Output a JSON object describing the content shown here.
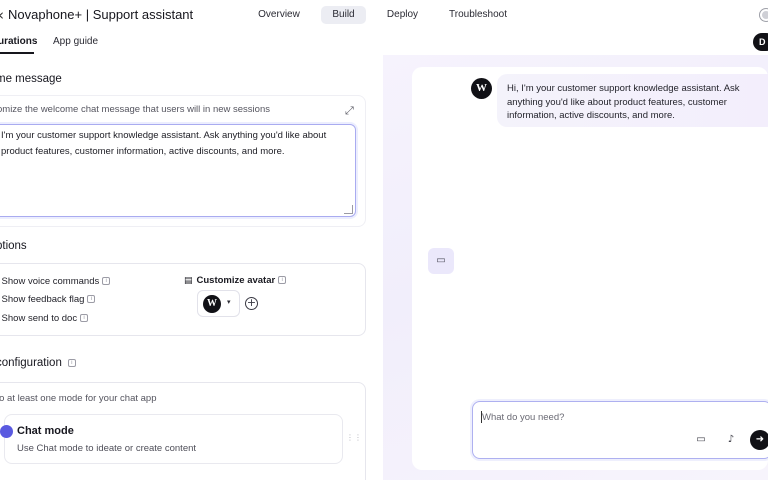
{
  "app": {
    "title": "Novaphone+ | Support assistant",
    "back_icon": "chevron-left-icon"
  },
  "nav": {
    "tabs": [
      {
        "label": "Overview",
        "active": false
      },
      {
        "label": "Build",
        "active": true
      },
      {
        "label": "Deploy",
        "active": false
      },
      {
        "label": "Troubleshoot",
        "active": false
      }
    ]
  },
  "subtabs": {
    "configurations": "urations",
    "app_guide": "App guide"
  },
  "top_right_pill": "D",
  "welcome": {
    "title": "me message",
    "hint": "omize the welcome chat message that users will in new sessions",
    "value": "I'm your customer support knowledge assistant. Ask anything you'd like about\nproduct features, customer information, active discounts, and more.",
    "expand_icon": "expand-icon"
  },
  "options": {
    "title": "ptions",
    "items": [
      {
        "label": "Show voice commands",
        "info": "i"
      },
      {
        "label": "Show feedback flag",
        "info": "i"
      },
      {
        "label": "Show send to doc",
        "info": "i"
      }
    ],
    "avatar": {
      "label": "Customize avatar",
      "info": "i",
      "selected_glyph": "W",
      "caret": "▾",
      "add_glyph": "+"
    }
  },
  "configuration": {
    "title": "configuration",
    "info": "i",
    "hint": "lo at least one mode for your chat app",
    "mode": {
      "title": "Chat mode",
      "description": "Use Chat mode to ideate or create content",
      "color": "#5a5ae0"
    }
  },
  "chat": {
    "bot_avatar_glyph": "W",
    "bot_message": "Hi, I'm your customer support knowledge assistant. Ask anything you'd like about product features, customer information, active discounts, and more.",
    "composer_placeholder": "What do you need?",
    "side_button_icon": "chat-icon"
  },
  "colors": {
    "accent": "#5a5ae0",
    "chat_bg": "#f3f0fc",
    "focus_border": "#a9abf0"
  }
}
